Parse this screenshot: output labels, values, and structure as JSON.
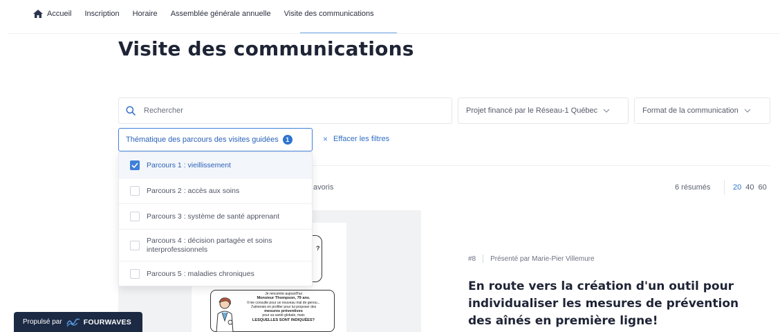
{
  "nav": {
    "items": [
      {
        "label": "Accueil",
        "icon": "home-icon"
      },
      {
        "label": "Inscription"
      },
      {
        "label": "Horaire"
      },
      {
        "label": "Assemblée générale annuelle"
      },
      {
        "label": "Visite des communications",
        "active": true
      }
    ]
  },
  "page_title": "Visite des communications",
  "filters": {
    "search_placeholder": "Rechercher",
    "funded_label": "Projet financé par le Réseau-1 Québec",
    "format_label": "Format de la communication",
    "theme_label": "Thématique des parcours des visites guidées",
    "theme_count": "1",
    "clear_label": "Effacer les filtres"
  },
  "dropdown": {
    "options": [
      {
        "label": "Parcours 1 : vieillissement",
        "checked": true
      },
      {
        "label": "Parcours 2 : accès aux soins",
        "checked": false
      },
      {
        "label": "Parcours 3 : système de santé apprenant",
        "checked": false
      },
      {
        "label": "Parcours 4 : décision partagée et soins interprofessionnels",
        "checked": false
      },
      {
        "label": "Parcours 5 : maladies chroniques",
        "checked": false
      }
    ]
  },
  "results": {
    "favorites_partial": "avoris",
    "count": "6 résumés",
    "per_page": [
      "20",
      "40",
      "60"
    ],
    "per_page_active": "20"
  },
  "card": {
    "number": "#8",
    "presenter": "Présenté par Marie-Pier Villemure",
    "title": "En route vers la création d'un outil pour individualiser les mesures de prévention des aînés en première ligne!",
    "comic_lines": {
      "l1": "Je rencontre aujourd'hui",
      "l2": "Monsieur Thompson, 79 ans.",
      "l3": "Il me consulte pour un nouveau mal de genou...",
      "l4": "J'aimerais en profiter pour lui proposer des",
      "l5": "mesures préventives",
      "l6": "pour sa santé globale, mais",
      "l7": "LESQUELLES SONT INDIQUÉES?"
    },
    "comic_bubble_mark": "?"
  },
  "powered": {
    "prefix": "Propulsé par",
    "brand": "FOURWAVES"
  },
  "colors": {
    "accent": "#2f74d0",
    "dark": "#1c2a44",
    "text": "#1e2435"
  }
}
